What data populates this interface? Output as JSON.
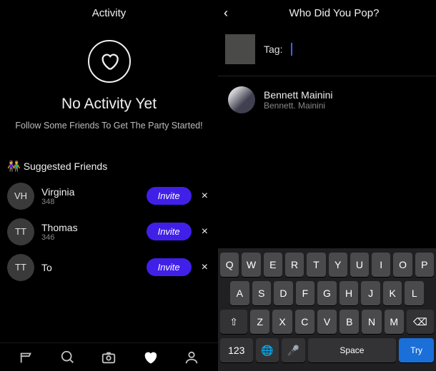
{
  "left": {
    "header_title": "Activity",
    "empty": {
      "title": "No Activity Yet",
      "subtitle": "Follow Some Friends To Get The Party Started!"
    },
    "suggested_label": "Suggested Friends",
    "friends": [
      {
        "initials": "VH",
        "name": "Virginia",
        "sub": "348",
        "invite": "Invite"
      },
      {
        "initials": "TT",
        "name": "Thomas",
        "sub": "346",
        "invite": "Invite"
      },
      {
        "initials": "TT",
        "name": "To",
        "sub": "",
        "invite": "Invite"
      }
    ],
    "dismiss": "×"
  },
  "right": {
    "header_title": "Who Did You Pop?",
    "tag_label": "Tag:",
    "tag_value": "",
    "user": {
      "name": "Bennett Mainini",
      "sub": "Bennett. Mainini"
    },
    "keyboard": {
      "row1": [
        "Q",
        "W",
        "E",
        "R",
        "T",
        "Y",
        "U",
        "I",
        "O",
        "P"
      ],
      "row2": [
        "A",
        "S",
        "D",
        "F",
        "G",
        "H",
        "J",
        "K",
        "L"
      ],
      "row3_shift": "⇧",
      "row3": [
        "Z",
        "X",
        "C",
        "V",
        "B",
        "N",
        "M"
      ],
      "row3_del": "⌫",
      "row4_num": "123",
      "row4_globe": "🌐",
      "row4_mic": "🎤",
      "row4_space": "Space",
      "row4_action": "Try"
    }
  }
}
